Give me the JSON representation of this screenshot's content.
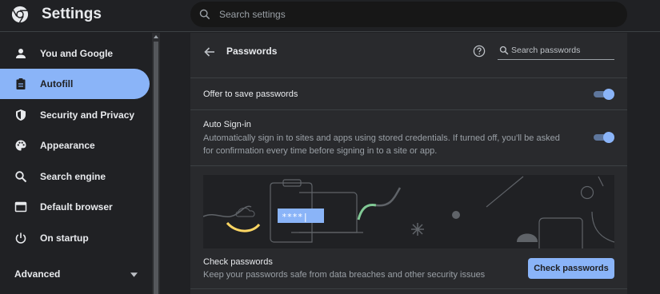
{
  "header": {
    "title": "Settings",
    "search_placeholder": "Search settings"
  },
  "sidebar": {
    "items": [
      {
        "label": "You and Google",
        "icon": "person-icon"
      },
      {
        "label": "Autofill",
        "icon": "clipboard-icon",
        "active": true
      },
      {
        "label": "Security and Privacy",
        "icon": "shield-icon"
      },
      {
        "label": "Appearance",
        "icon": "palette-icon"
      },
      {
        "label": "Search engine",
        "icon": "search-icon"
      },
      {
        "label": "Default browser",
        "icon": "browser-window-icon"
      },
      {
        "label": "On startup",
        "icon": "power-icon"
      }
    ],
    "advanced_label": "Advanced"
  },
  "passwords": {
    "title": "Passwords",
    "search_placeholder": "Search passwords",
    "offer_to_save": {
      "label": "Offer to save passwords",
      "enabled": true
    },
    "auto_signin": {
      "label": "Auto Sign-in",
      "description": "Automatically sign in to sites and apps using stored credentials. If turned off, you'll be asked for confirmation every time before signing in to a site or app.",
      "enabled": true
    },
    "banner_password_mask": "****|",
    "check": {
      "label": "Check passwords",
      "description": "Keep your passwords safe from data breaches and other security issues",
      "button": "Check passwords"
    }
  },
  "colors": {
    "background": "#202124",
    "card": "#292a2d",
    "accent": "#8ab4f8",
    "text": "#e8eaed",
    "secondary_text": "#9aa0a6"
  }
}
